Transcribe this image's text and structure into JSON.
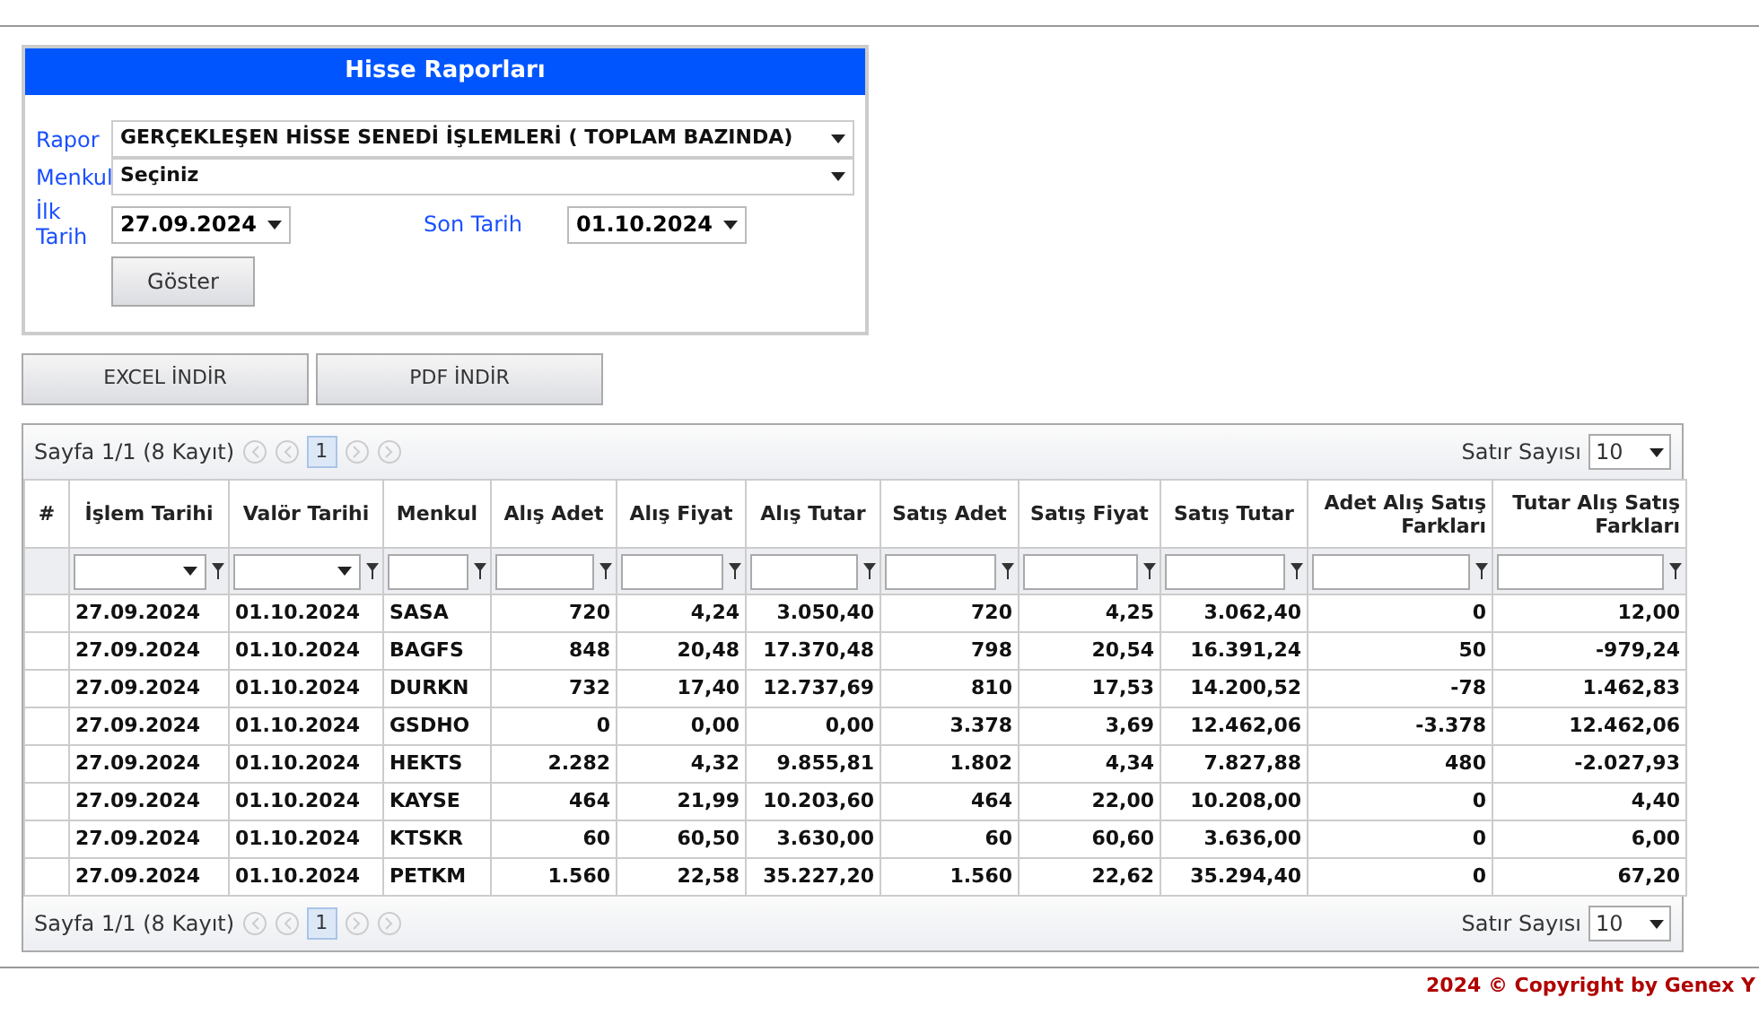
{
  "report_panel": {
    "title": "Hisse Raporları",
    "fields": [
      {
        "label": "Rapor",
        "value": "GERÇEKLEŞEN HİSSE SENEDİ İŞLEMLERİ ( TOPLAM BAZINDA)"
      },
      {
        "label": "Menkul",
        "value": "Seçiniz"
      }
    ],
    "start_date": {
      "label": "İlk Tarih",
      "value": "27.09.2024"
    },
    "end_date": {
      "label": "Son Tarih",
      "value": "01.10.2024"
    },
    "show_button": "Göster"
  },
  "export_buttons": [
    "EXCEL İNDİR",
    "PDF İNDİR"
  ],
  "grid": {
    "pager_top": {
      "info": "Sayfa 1/1 (8 Kayıt)",
      "pages": [
        {
          "label": "1",
          "selected": true
        }
      ],
      "rows_label": "Satır Sayısı",
      "rows_value": "10"
    },
    "columns": [
      {
        "label": "#",
        "kind": "index"
      },
      {
        "label": "İşlem Tarihi",
        "kind": "date"
      },
      {
        "label": "Valör Tarihi",
        "kind": "date"
      },
      {
        "label": "Menkul",
        "kind": "text"
      },
      {
        "label": "Alış Adet",
        "kind": "number"
      },
      {
        "label": "Alış Fiyat",
        "kind": "number"
      },
      {
        "label": "Alış Tutar",
        "kind": "number"
      },
      {
        "label": "Satış Adet",
        "kind": "number"
      },
      {
        "label": "Satış Fiyat",
        "kind": "number"
      },
      {
        "label": "Satış Tutar",
        "kind": "number"
      },
      {
        "label": "Adet Alış Satış Farkları",
        "kind": "number"
      },
      {
        "label": "Tutar Alış Satış Farkları",
        "kind": "number"
      }
    ],
    "rows": [
      [
        "",
        "27.09.2024",
        "01.10.2024",
        "SASA",
        "720",
        "4,24",
        "3.050,40",
        "720",
        "4,25",
        "3.062,40",
        "0",
        "12,00"
      ],
      [
        "",
        "27.09.2024",
        "01.10.2024",
        "BAGFS",
        "848",
        "20,48",
        "17.370,48",
        "798",
        "20,54",
        "16.391,24",
        "50",
        "-979,24"
      ],
      [
        "",
        "27.09.2024",
        "01.10.2024",
        "DURKN",
        "732",
        "17,40",
        "12.737,69",
        "810",
        "17,53",
        "14.200,52",
        "-78",
        "1.462,83"
      ],
      [
        "",
        "27.09.2024",
        "01.10.2024",
        "GSDHO",
        "0",
        "0,00",
        "0,00",
        "3.378",
        "3,69",
        "12.462,06",
        "-3.378",
        "12.462,06"
      ],
      [
        "",
        "27.09.2024",
        "01.10.2024",
        "HEKTS",
        "2.282",
        "4,32",
        "9.855,81",
        "1.802",
        "4,34",
        "7.827,88",
        "480",
        "-2.027,93"
      ],
      [
        "",
        "27.09.2024",
        "01.10.2024",
        "KAYSE",
        "464",
        "21,99",
        "10.203,60",
        "464",
        "22,00",
        "10.208,00",
        "0",
        "4,40"
      ],
      [
        "",
        "27.09.2024",
        "01.10.2024",
        "KTSKR",
        "60",
        "60,50",
        "3.630,00",
        "60",
        "60,60",
        "3.636,00",
        "0",
        "6,00"
      ],
      [
        "",
        "27.09.2024",
        "01.10.2024",
        "PETKM",
        "1.560",
        "22,58",
        "35.227,20",
        "1.560",
        "22,62",
        "35.294,40",
        "0",
        "67,20"
      ]
    ],
    "pager_bottom": {
      "info": "Sayfa 1/1 (8 Kayıt)",
      "pages": [
        {
          "label": "1",
          "selected": true
        }
      ],
      "rows_label": "Satır Sayısı",
      "rows_value": "10"
    }
  },
  "footer": "2024 © Copyright by Genex Y"
}
